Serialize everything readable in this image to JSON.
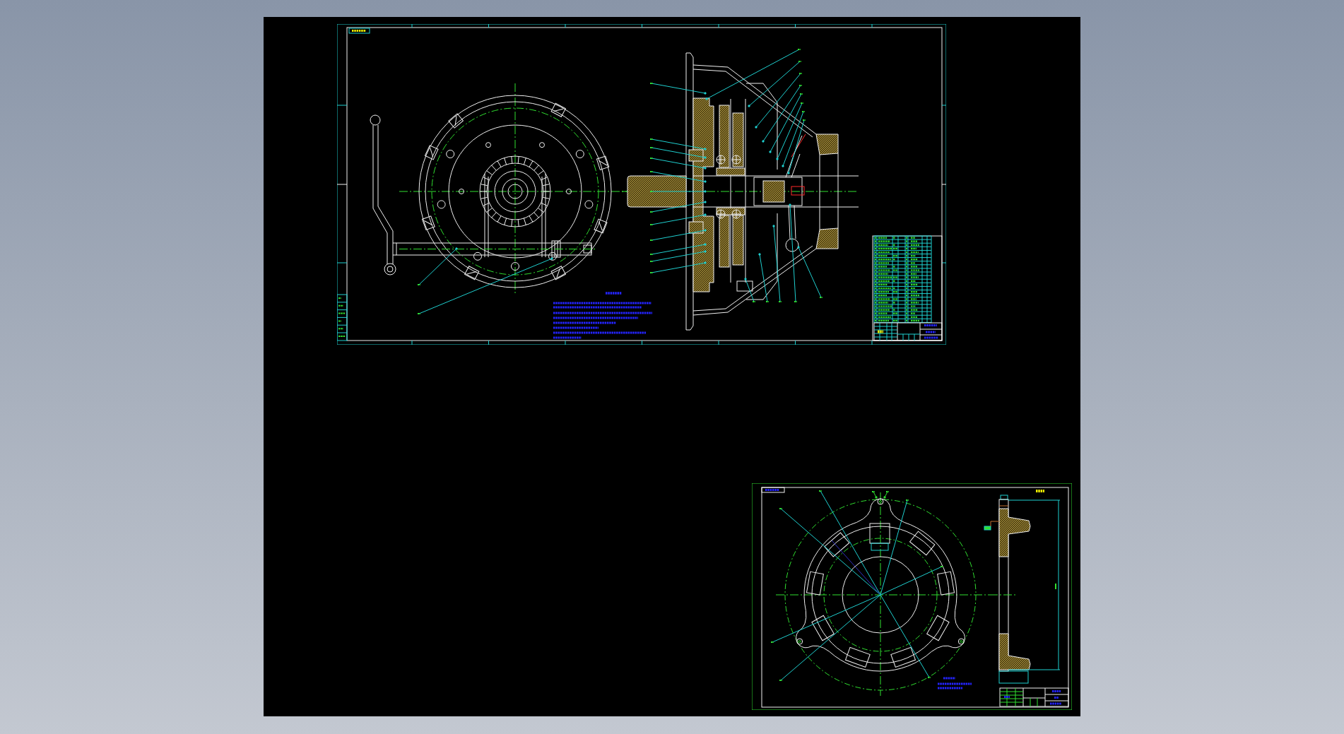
{
  "sheets": [
    {
      "kind": "assembly"
    },
    {
      "kind": "part"
    }
  ]
}
